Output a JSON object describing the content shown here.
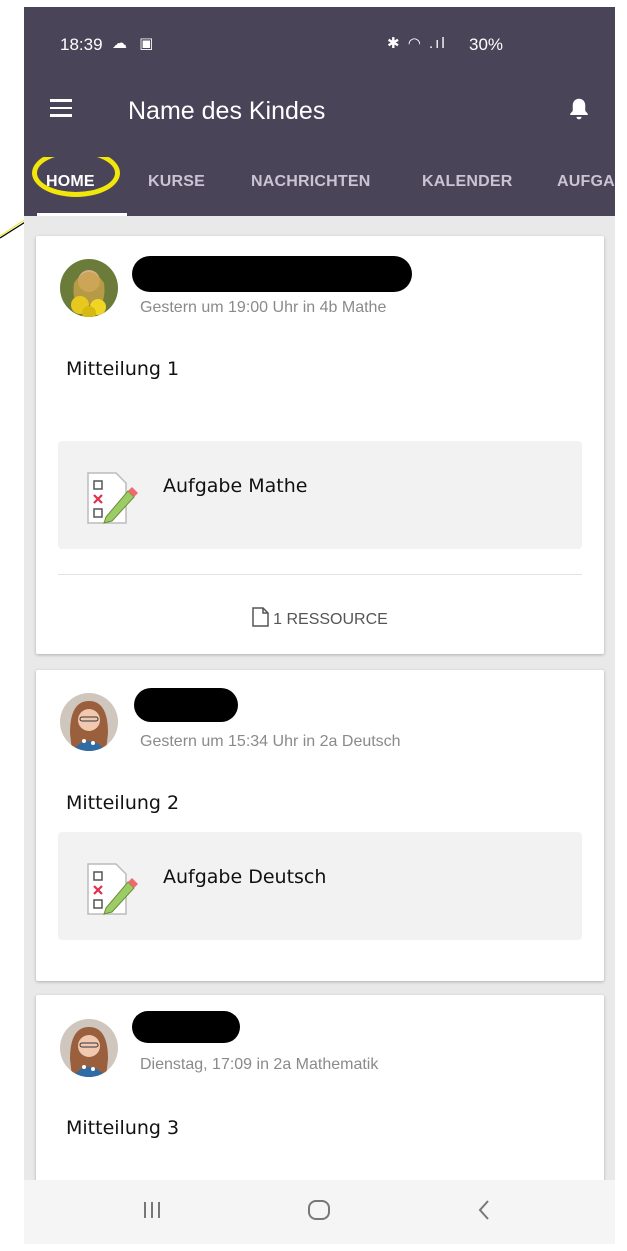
{
  "status_bar": {
    "time": "18:39",
    "left_icons": "☁ ▣",
    "right_icons": "✱ ◠ .ıl",
    "battery": "30%"
  },
  "app_bar": {
    "title": "Name des Kindes"
  },
  "tabs": [
    "HOME",
    "KURSE",
    "NACHRICHTEN",
    "KALENDER",
    "AUFGA"
  ],
  "posts": [
    {
      "meta": "Gestern um 19:00 Uhr in 4b Mathe",
      "message": "Mitteilung 1",
      "assignment": "Aufgabe Mathe",
      "resource": "1 RESSOURCE"
    },
    {
      "meta": "Gestern um 15:34 Uhr in 2a Deutsch",
      "message": "Mitteilung 2",
      "assignment": "Aufgabe Deutsch"
    },
    {
      "meta": "Dienstag, 17:09 in 2a Mathematik",
      "message": "Mitteilung 3"
    }
  ],
  "colors": {
    "header": "#4a4458",
    "highlight_ring": "#f2e60a",
    "card": "#ffffff",
    "background": "#e9e9e9"
  },
  "icons": [
    "menu-icon",
    "bell-icon",
    "assignment-icon",
    "document-icon",
    "recents-icon",
    "home-circle-icon",
    "back-icon"
  ]
}
